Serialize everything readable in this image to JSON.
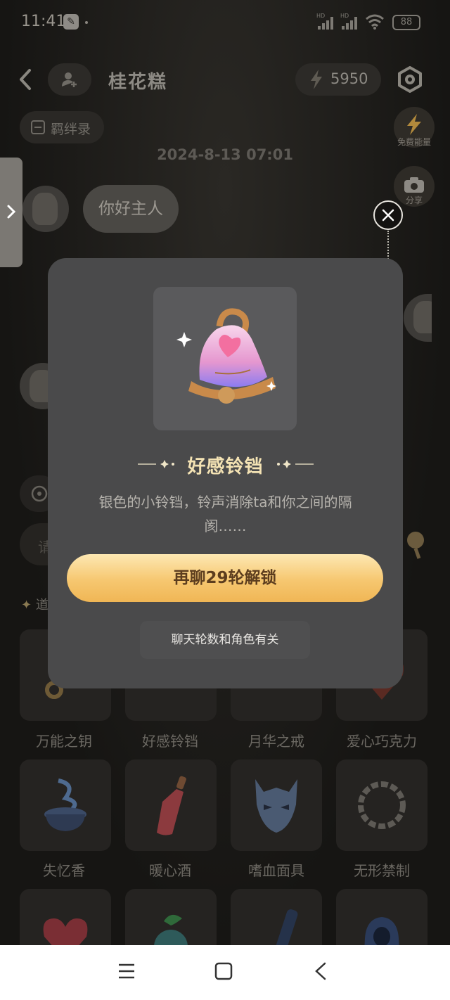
{
  "status_bar": {
    "time": "11:41",
    "hd1": "HD",
    "hd2": "HD",
    "battery": "88"
  },
  "header": {
    "title": "桂花糕",
    "energy": "5950"
  },
  "bond_button": {
    "label": "羁绊录"
  },
  "side_actions": {
    "free_energy_label": "免费能量",
    "share_label": "分享"
  },
  "chat": {
    "datestamp": "2024-8-13 07:01",
    "first_message": "你好主人"
  },
  "tools_label": "道",
  "input_hint": "请",
  "grid": {
    "row1": [
      "万能之钥",
      "好感铃铛",
      "月华之戒",
      "爱心巧克力"
    ],
    "row2": [
      "失忆香",
      "暖心酒",
      "嗜血面具",
      "无形禁制"
    ]
  },
  "modal": {
    "item_name": "好感铃铛",
    "item_description": "银色的小铃铛，铃声消除ta和你之间的隔阂……",
    "unlock_button": "再聊29轮解锁",
    "hint": "聊天轮数和角色有关"
  },
  "colors": {
    "accent_gold": "#f6c770",
    "modal_bg": "#4a4a4b",
    "item_name": "#f4e3b4"
  },
  "icons": [
    "back-icon",
    "add-user-icon",
    "bolt-icon",
    "settings-icon",
    "share-camera-icon",
    "close-icon",
    "bell-icon",
    "menu-icon",
    "home-icon",
    "nav-back-icon"
  ]
}
